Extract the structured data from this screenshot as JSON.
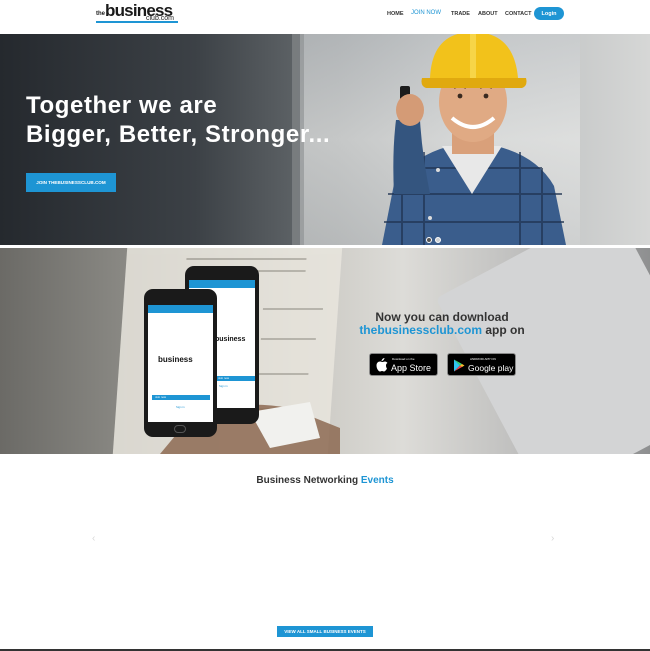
{
  "logo": {
    "the": "the",
    "business": "business",
    "club": "club.com"
  },
  "nav": {
    "home": "HOME",
    "join_now": "JOIN NOW",
    "trade": "TRADE",
    "about": "ABOUT",
    "contact": "CONTACT",
    "login": "Login"
  },
  "hero": {
    "line1": "Together we are",
    "line2": "Bigger, Better, Stronger...",
    "cta": "JOIN THEBUSINESSCLUB.COM",
    "slide_active": 1,
    "slide_count": 2
  },
  "app": {
    "line1": "Now you can download",
    "link": "thebusinessclub.com",
    "line2_suffix": " app on",
    "appstore_small": "Download on the",
    "appstore_big": "App Store",
    "googleplay_small": "ANDROID APP ON",
    "googleplay_big": "Google play",
    "phone_join": "Join now",
    "phone_signin": "Sign in"
  },
  "events": {
    "title": "Business Networking",
    "title_highlight": "Events",
    "prev": "‹",
    "next": "›",
    "view_all": "VIEW ALL SMALL BUSINESS EVENTS"
  },
  "colors": {
    "accent": "#1e95d4",
    "text_dark": "#333333"
  }
}
